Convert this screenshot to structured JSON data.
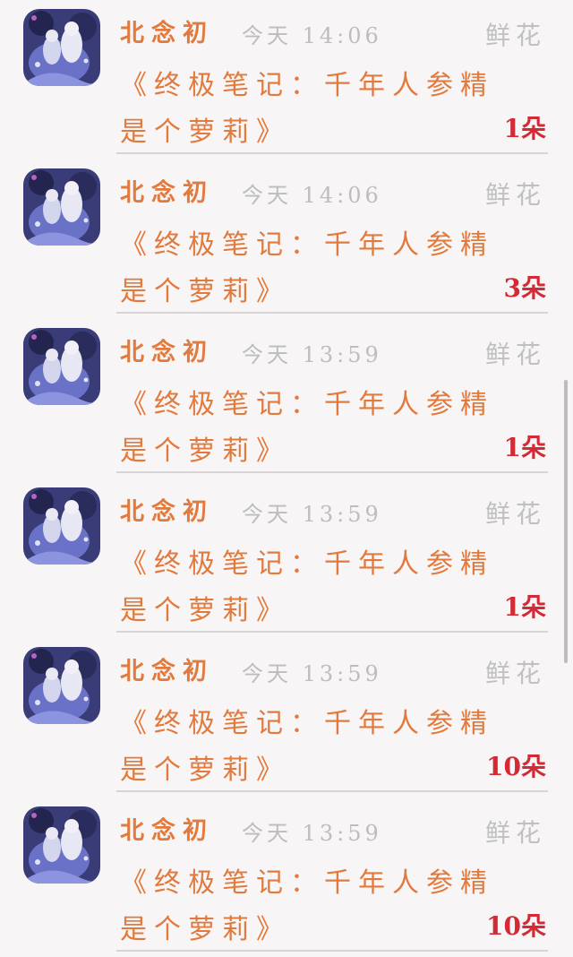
{
  "colors": {
    "name": "#e27a3d",
    "title": "#e27a3d",
    "count": "#d42a36",
    "time": "#bdbdbd",
    "gift": "#c0c0c0"
  },
  "records": [
    {
      "user": "北念初",
      "time": "今天 14:06",
      "gift_type": "鲜花",
      "title": "《终极笔记：千年人参精是个萝莉》",
      "count": "1朵"
    },
    {
      "user": "北念初",
      "time": "今天 14:06",
      "gift_type": "鲜花",
      "title": "《终极笔记：千年人参精是个萝莉》",
      "count": "3朵"
    },
    {
      "user": "北念初",
      "time": "今天 13:59",
      "gift_type": "鲜花",
      "title": "《终极笔记：千年人参精是个萝莉》",
      "count": "1朵"
    },
    {
      "user": "北念初",
      "time": "今天 13:59",
      "gift_type": "鲜花",
      "title": "《终极笔记：千年人参精是个萝莉》",
      "count": "1朵"
    },
    {
      "user": "北念初",
      "time": "今天 13:59",
      "gift_type": "鲜花",
      "title": "《终极笔记：千年人参精是个萝莉》",
      "count": "10朵"
    },
    {
      "user": "北念初",
      "time": "今天 13:59",
      "gift_type": "鲜花",
      "title": "《终极笔记：千年人参精是个萝莉》",
      "count": "10朵"
    }
  ]
}
